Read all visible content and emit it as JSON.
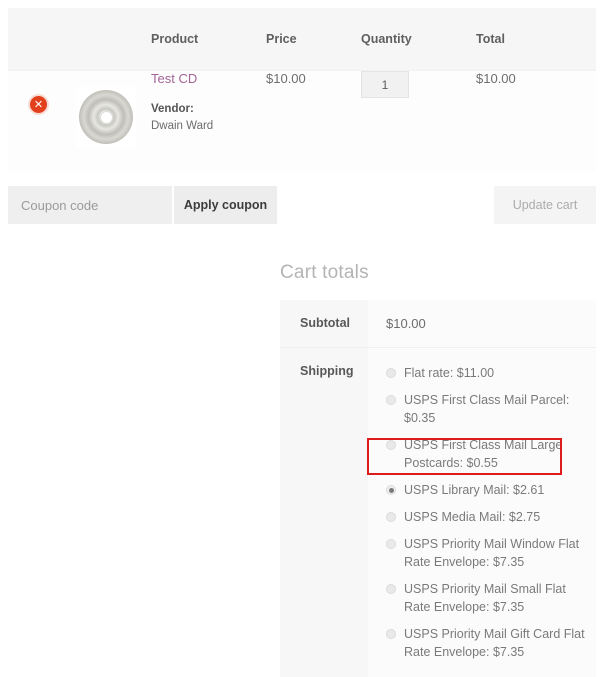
{
  "cart_table": {
    "headers": [
      "",
      "",
      "Product",
      "Price",
      "Quantity",
      "Total"
    ],
    "row": {
      "remove_icon": "remove-x-icon",
      "remove_symbol": "✕",
      "thumbnail_icon": "cd-disc-image",
      "product_name": "Test CD",
      "vendor_label": "Vendor:",
      "vendor_name": "Dwain Ward",
      "price": "$10.00",
      "quantity": "1",
      "total": "$10.00"
    }
  },
  "coupon": {
    "placeholder": "Coupon code",
    "value": "",
    "apply_label": "Apply coupon",
    "update_label": "Update cart"
  },
  "totals": {
    "title": "Cart totals",
    "subtotal_label": "Subtotal",
    "subtotal_value": "$10.00",
    "shipping_label": "Shipping",
    "shipping_options": [
      {
        "label": "Flat rate: $11.00",
        "selected": false
      },
      {
        "label": "USPS First Class Mail Parcel: $0.35",
        "selected": false
      },
      {
        "label": "USPS First Class Mail Large Postcards: $0.55",
        "selected": false
      },
      {
        "label": "USPS Library Mail: $2.61",
        "selected": true
      },
      {
        "label": "USPS Media Mail: $2.75",
        "selected": false
      },
      {
        "label": "USPS Priority Mail Window Flat Rate Envelope: $7.35",
        "selected": false
      },
      {
        "label": "USPS Priority Mail Small Flat Rate Envelope: $7.35",
        "selected": false
      },
      {
        "label": "USPS Priority Mail Gift Card Flat Rate Envelope: $7.35",
        "selected": false
      }
    ]
  },
  "annotation": {
    "highlight_color": "#e01b1b"
  }
}
